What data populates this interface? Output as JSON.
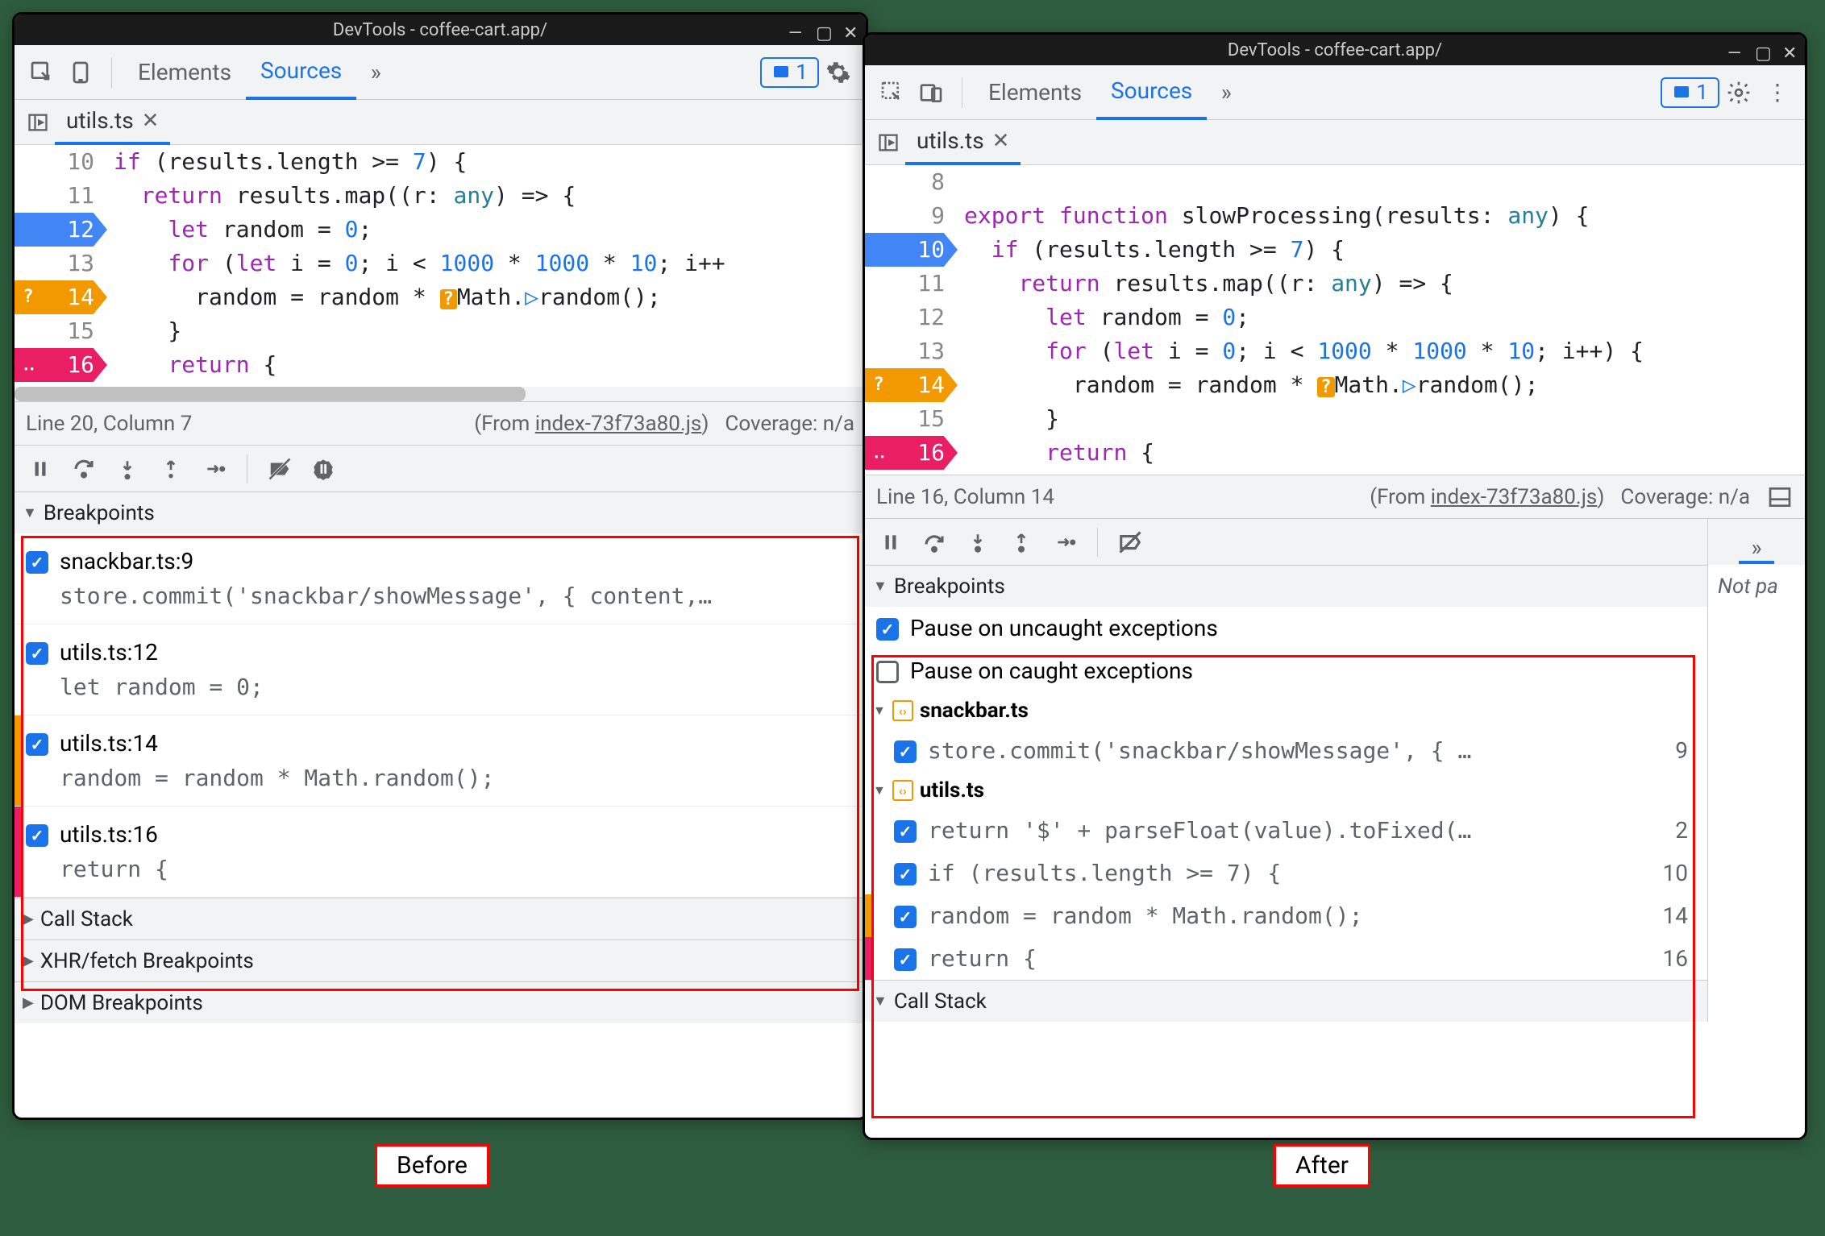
{
  "title": "DevTools - coffee-cart.app/",
  "tabs": {
    "elements": "Elements",
    "sources": "Sources"
  },
  "fileTab": "utils.ts",
  "before": {
    "code": [
      {
        "n": 10,
        "html": "<span class='kw'>if</span> (results.length >= <span class='num'>7</span>) {"
      },
      {
        "n": 11,
        "html": "  <span class='kw'>return</span> results.<span class='fn'>map</span>((<span>r</span>: <span class='type'>any</span>) => {"
      },
      {
        "n": 12,
        "html": "    <span class='kw'>let</span> random = <span class='num'>0</span>;",
        "bp": "blue"
      },
      {
        "n": 13,
        "html": "    <span class='kw'>for</span> (<span class='kw'>let</span> i = <span class='num'>0</span>; i < <span class='num'>1000</span> * <span class='num'>1000</span> * <span class='num'>10</span>; i++"
      },
      {
        "n": 14,
        "html": "      random = random * <span class='math-badge'>?</span>Math.<span class='rand-badge'>▷</span>random();",
        "bp": "orange",
        "q": true
      },
      {
        "n": 15,
        "html": "    }"
      },
      {
        "n": 16,
        "html": "    <span class='kw'>return</span> {",
        "bp": "pink",
        "dots": true
      }
    ],
    "status": {
      "pos": "Line 20, Column 7",
      "from": "(From ",
      "link": "index-73f73a80.js",
      "paren": ")",
      "coverage": "Coverage: n/a"
    },
    "panes": {
      "breakpoints": "Breakpoints",
      "callstack": "Call Stack",
      "xhr": "XHR/fetch Breakpoints",
      "dom": "DOM Breakpoints"
    },
    "bps": [
      {
        "title": "snackbar.ts:9",
        "code": "store.commit('snackbar/showMessage', { content,…"
      },
      {
        "title": "utils.ts:12",
        "code": "let random = 0;"
      },
      {
        "title": "utils.ts:14",
        "code": "random = random * Math.random();",
        "strip": "orange"
      },
      {
        "title": "utils.ts:16",
        "code": "return {",
        "strip": "pink"
      }
    ]
  },
  "after": {
    "code": [
      {
        "n": 8,
        "html": ""
      },
      {
        "n": 9,
        "html": "<span class='kw'>export</span> <span class='kw'>function</span> <span class='fn'>slowProcessing</span>(<span>results</span>: <span class='type'>any</span>) {"
      },
      {
        "n": 10,
        "html": "  <span class='kw'>if</span> (results.length >= <span class='num'>7</span>) {",
        "bp": "blue"
      },
      {
        "n": 11,
        "html": "    <span class='kw'>return</span> results.<span class='fn'>map</span>((<span>r</span>: <span class='type'>any</span>) => {"
      },
      {
        "n": 12,
        "html": "      <span class='kw'>let</span> random = <span class='num'>0</span>;"
      },
      {
        "n": 13,
        "html": "      <span class='kw'>for</span> (<span class='kw'>let</span> i = <span class='num'>0</span>; i < <span class='num'>1000</span> * <span class='num'>1000</span> * <span class='num'>10</span>; i++) {"
      },
      {
        "n": 14,
        "html": "        random = random * <span class='math-badge'>?</span>Math.<span class='rand-badge'>▷</span>random();",
        "bp": "orange",
        "q": true
      },
      {
        "n": 15,
        "html": "      }"
      },
      {
        "n": 16,
        "html": "      <span class='kw'>return</span> {",
        "bp": "pink",
        "dots": true
      }
    ],
    "status": {
      "pos": "Line 16, Column 14",
      "from": "(From ",
      "link": "index-73f73a80.js",
      "paren": ")",
      "coverage": "Coverage: n/a"
    },
    "panes": {
      "breakpoints": "Breakpoints",
      "callstack": "Call Stack"
    },
    "pauseUncaught": "Pause on uncaught exceptions",
    "pauseCaught": "Pause on caught exceptions",
    "groups": [
      {
        "file": "snackbar.ts",
        "items": [
          {
            "code": "store.commit('snackbar/showMessage', { …",
            "line": 9
          }
        ]
      },
      {
        "file": "utils.ts",
        "items": [
          {
            "code": "return '$' + parseFloat(value).toFixed(…",
            "line": 2
          },
          {
            "code": "if (results.length >= 7) {",
            "line": 10
          },
          {
            "code": "random = random * Math.random();",
            "line": 14,
            "strip": "orange"
          },
          {
            "code": "return {",
            "line": 16,
            "strip": "pink"
          }
        ]
      }
    ],
    "notPa": "Not pa"
  },
  "labels": {
    "before": "Before",
    "after": "After"
  },
  "badge": "1"
}
